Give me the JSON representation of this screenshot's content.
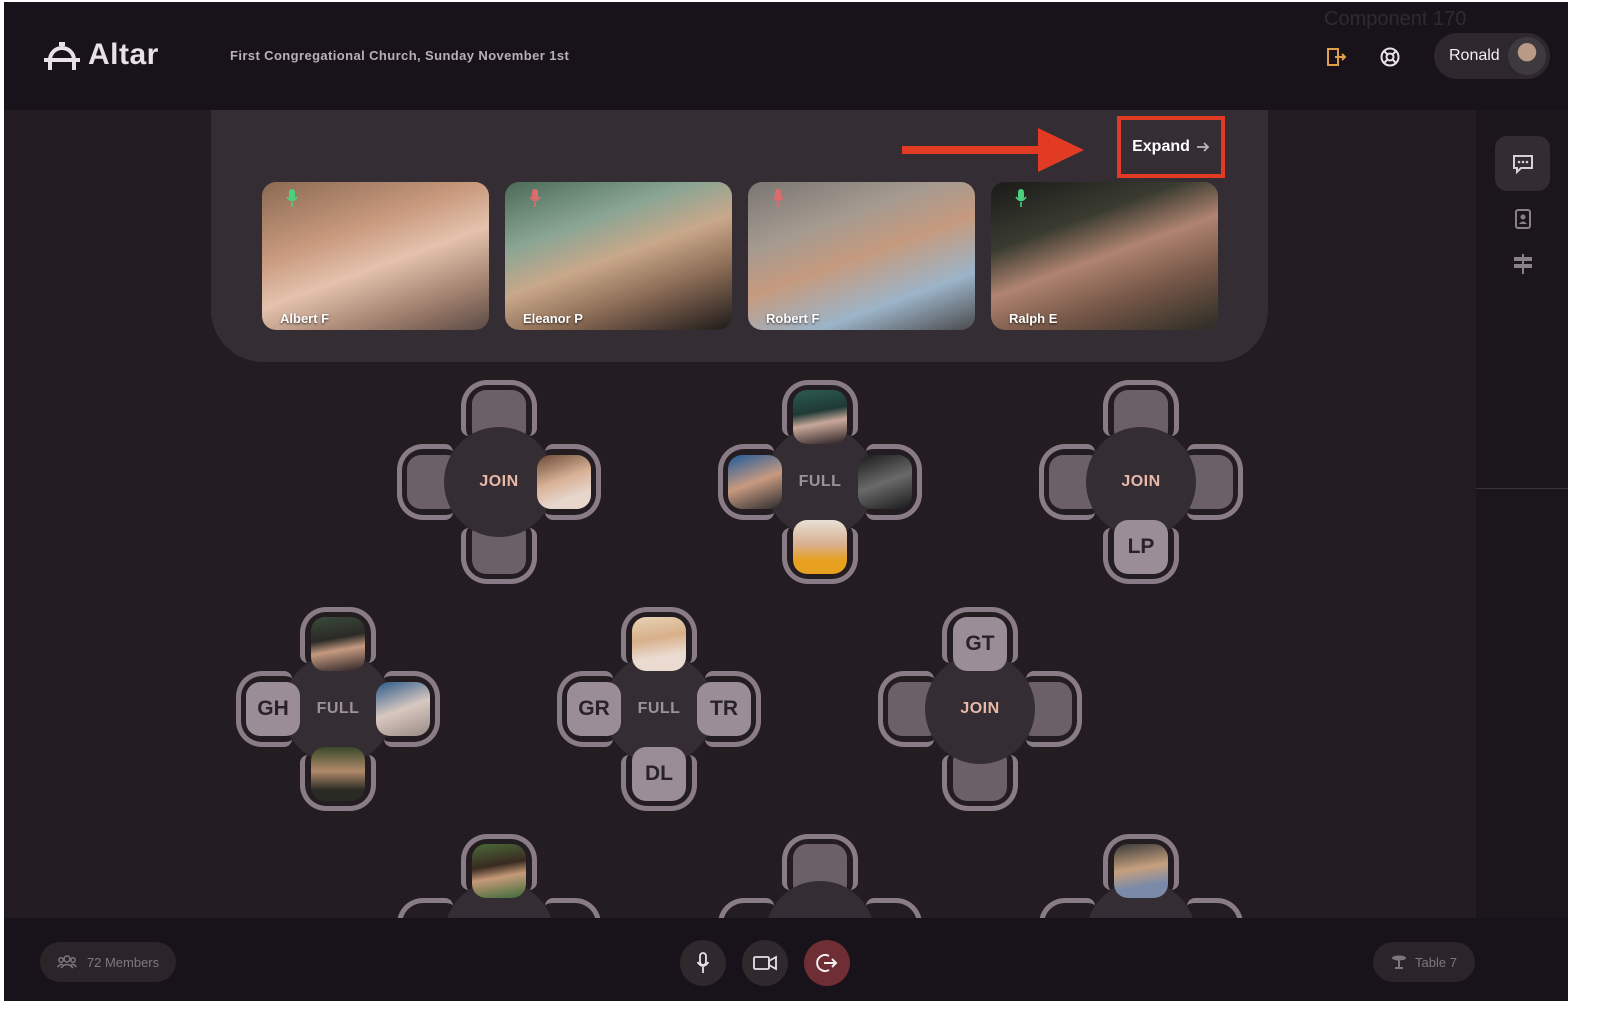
{
  "app": {
    "name": "Altar"
  },
  "header": {
    "event_title": "First Congregational Church, Sunday November 1st",
    "component_label": "Component 170",
    "user_name": "Ronald"
  },
  "speakers": {
    "expand_label": "Expand",
    "tiles": [
      {
        "name": "Albert F",
        "mic": "on",
        "mic_color": "#4cd07d"
      },
      {
        "name": "Eleanor P",
        "mic": "muted",
        "mic_color": "#e06b6b"
      },
      {
        "name": "Robert F",
        "mic": "muted",
        "mic_color": "#e06b6b"
      },
      {
        "name": "Ralph E",
        "mic": "on",
        "mic_color": "#4cd07d"
      }
    ]
  },
  "tables": [
    {
      "status": "JOIN",
      "seats": {
        "top": "",
        "left": "",
        "right": "photo",
        "bottom": ""
      }
    },
    {
      "status": "FULL",
      "seats": {
        "top": "photo",
        "left": "photo",
        "right": "photo",
        "bottom": "photo"
      }
    },
    {
      "status": "JOIN",
      "seats": {
        "top": "",
        "left": "",
        "right": "",
        "bottom": "LP"
      }
    },
    {
      "status": "FULL",
      "seats": {
        "top": "photo",
        "left": "GH",
        "right": "photo",
        "bottom": "photo"
      }
    },
    {
      "status": "FULL",
      "seats": {
        "top": "photo",
        "left": "GR",
        "right": "TR",
        "bottom": "DL"
      }
    },
    {
      "status": "JOIN",
      "seats": {
        "top": "GT",
        "left": "",
        "right": "",
        "bottom": ""
      }
    }
  ],
  "bottom": {
    "members_label": "72 Members",
    "table_label": "Table 7"
  },
  "colors": {
    "accent_join": "#e8b8a8",
    "leave_button": "#6e2e33",
    "highlight_box": "#e23b24",
    "exit_icon": "#e0a04a"
  }
}
